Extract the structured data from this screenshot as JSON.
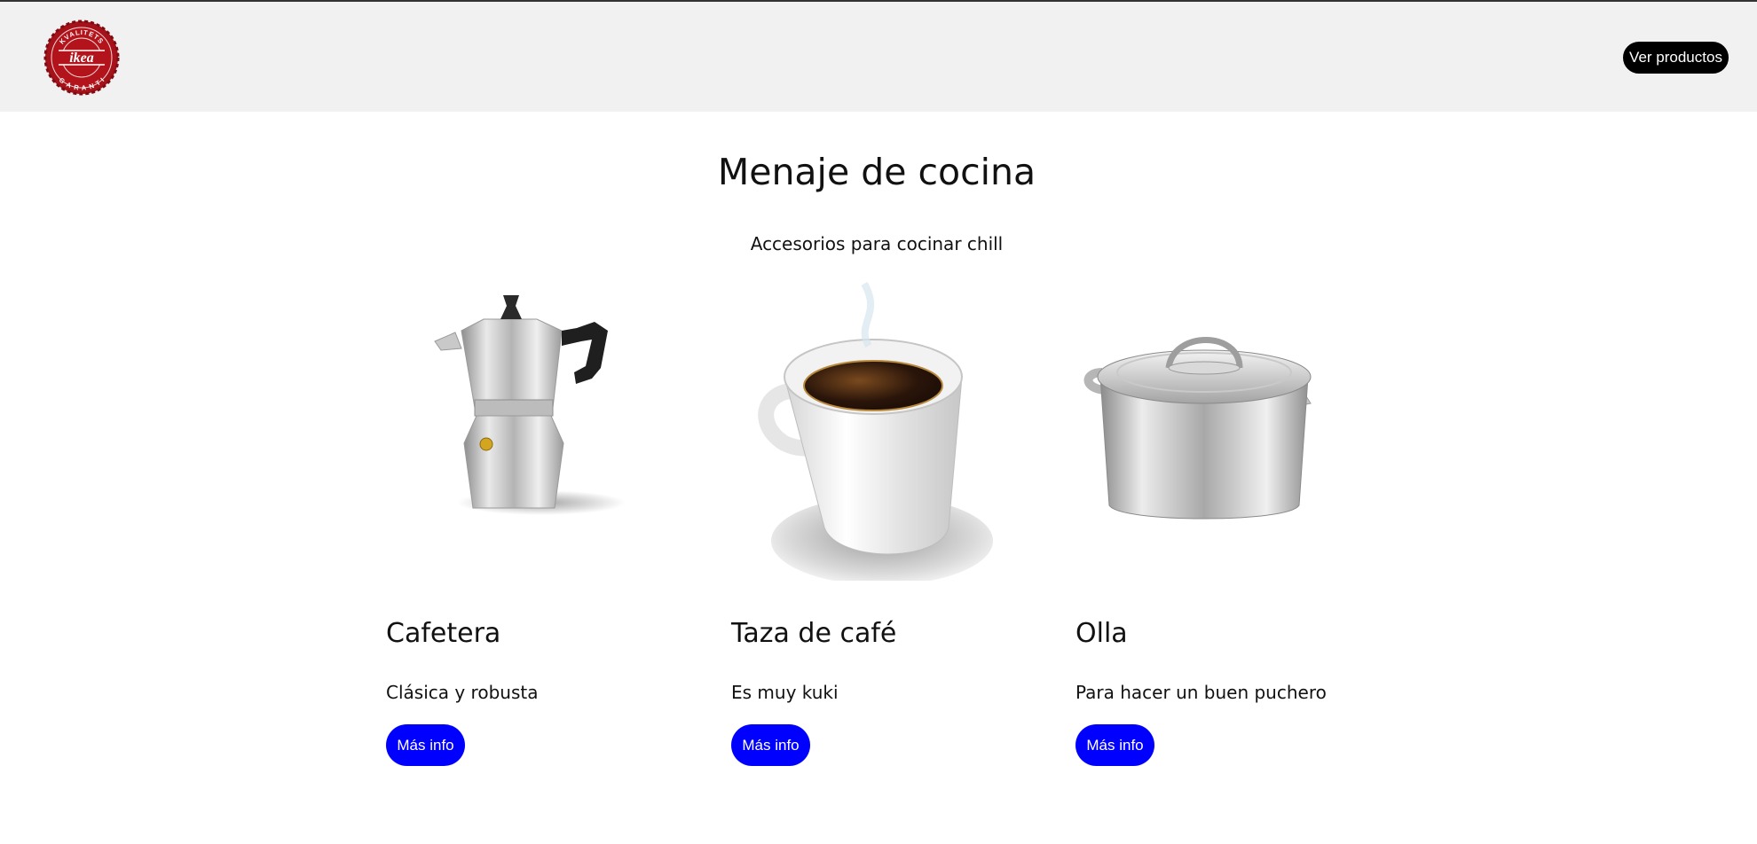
{
  "navbar": {
    "logo": {
      "icon": "ikea-seal-logo",
      "color": "#b3141c",
      "text_top": "KVALITETS",
      "text_center": "ikea",
      "text_bottom": "GARANTI"
    },
    "cta_label": "Ver productos"
  },
  "hero": {
    "title": "Menaje de cocina",
    "subtitle": "Accesorios para cocinar chill"
  },
  "products": [
    {
      "icon": "moka-pot-icon",
      "name": "Cafetera",
      "description": "Clásica y robusta",
      "button_label": "Más info"
    },
    {
      "icon": "coffee-cup-icon",
      "name": "Taza de café",
      "description": "Es muy kuki",
      "button_label": "Más info"
    },
    {
      "icon": "cooking-pot-icon",
      "name": "Olla",
      "description": "Para hacer un buen puchero",
      "button_label": "Más info"
    }
  ],
  "colors": {
    "navbar_bg": "#f1f1f1",
    "cta_bg": "#000000",
    "product_button_bg": "#0000ff"
  }
}
